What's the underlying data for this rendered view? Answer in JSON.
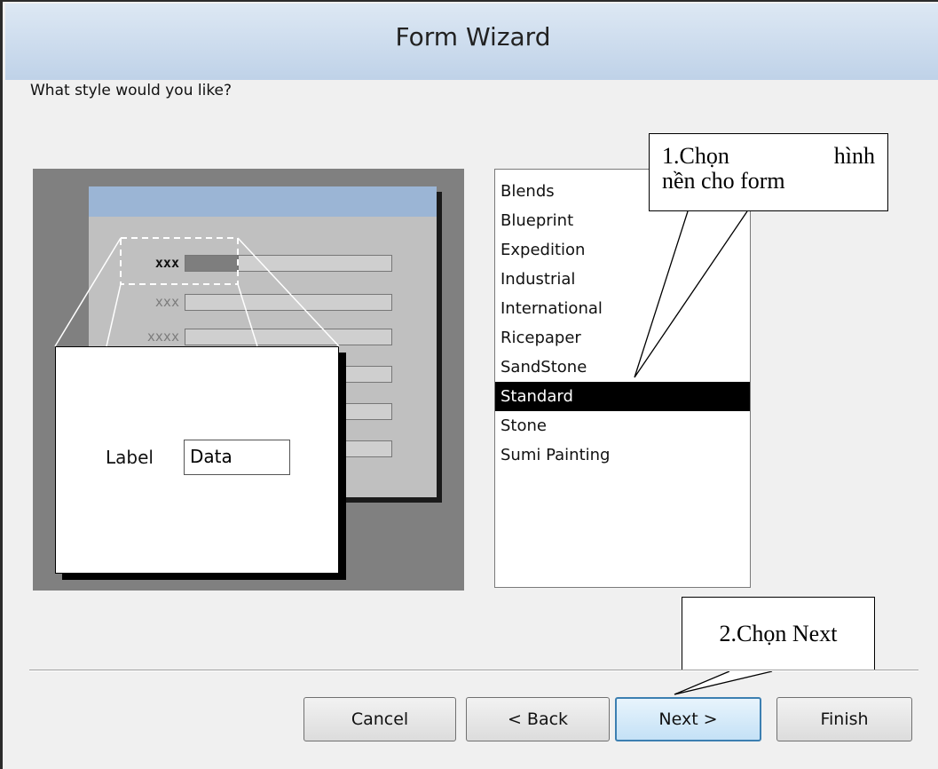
{
  "window": {
    "title": "Form Wizard"
  },
  "prompt": "What style would you like?",
  "preview": {
    "rows": [
      {
        "label": "xxx"
      },
      {
        "label": "xxx"
      },
      {
        "label": "xxxx"
      }
    ],
    "callout_label": "Label",
    "callout_data": "Data"
  },
  "styles": {
    "items": [
      "Blends",
      "Blueprint",
      "Expedition",
      "Industrial",
      "International",
      "Ricepaper",
      "SandStone",
      "Standard",
      "Stone",
      "Sumi Painting"
    ],
    "selected": "Standard"
  },
  "annotations": {
    "note1_word1": "1.Chọn",
    "note1_word2": "hình",
    "note1_line2": "nền cho form",
    "note2": "2.Chọn Next"
  },
  "buttons": {
    "cancel": "Cancel",
    "back": "< Back",
    "next": "Next >",
    "finish": "Finish"
  }
}
